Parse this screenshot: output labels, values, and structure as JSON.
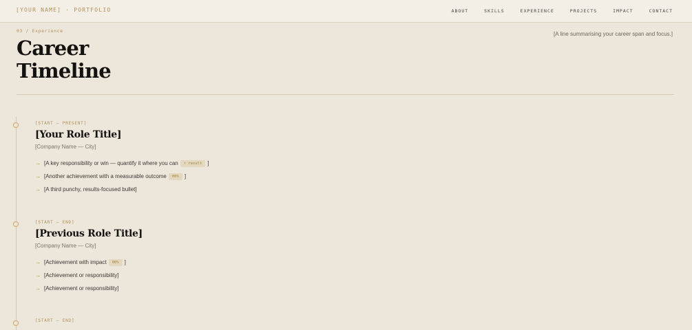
{
  "header": {
    "brand": "[YOUR NAME] · PORTFOLIO",
    "nav": [
      "ABOUT",
      "SKILLS",
      "EXPERIENCE",
      "PROJECTS",
      "IMPACT",
      "CONTACT"
    ]
  },
  "section": {
    "eyebrow": "03 / Experience",
    "title_line1": "Career",
    "title_line2": "Timeline",
    "summary": "[A line summarising your career span and focus.]"
  },
  "timeline": [
    {
      "period": "[START – PRESENT]",
      "role": "[Your Role Title]",
      "company": "[Company Name — City]",
      "bullets": [
        {
          "dash": "→",
          "text": "[A key responsibility or win — quantify it where you can",
          "tag": "↑ result",
          "suffix": "]"
        },
        {
          "dash": "→",
          "text": "[Another achievement with a measurable outcome",
          "tag": "00%",
          "suffix": "]"
        },
        {
          "dash": "→",
          "text": "[A third punchy, results-focused bullet]"
        }
      ]
    },
    {
      "period": "[START – END]",
      "role": "[Previous Role Title]",
      "company": "[Company Name — City]",
      "bullets": [
        {
          "dash": "→",
          "text": "[Achievement with impact",
          "tag": "00%",
          "suffix": "]"
        },
        {
          "dash": "→",
          "text": "[Achievement or responsibility]"
        },
        {
          "dash": "→",
          "text": "[Achievement or responsibility]"
        }
      ]
    },
    {
      "period": "[START – END]"
    }
  ],
  "colors": {
    "background": "#ede6da",
    "accent": "#b0905a",
    "heading": "#141210"
  }
}
